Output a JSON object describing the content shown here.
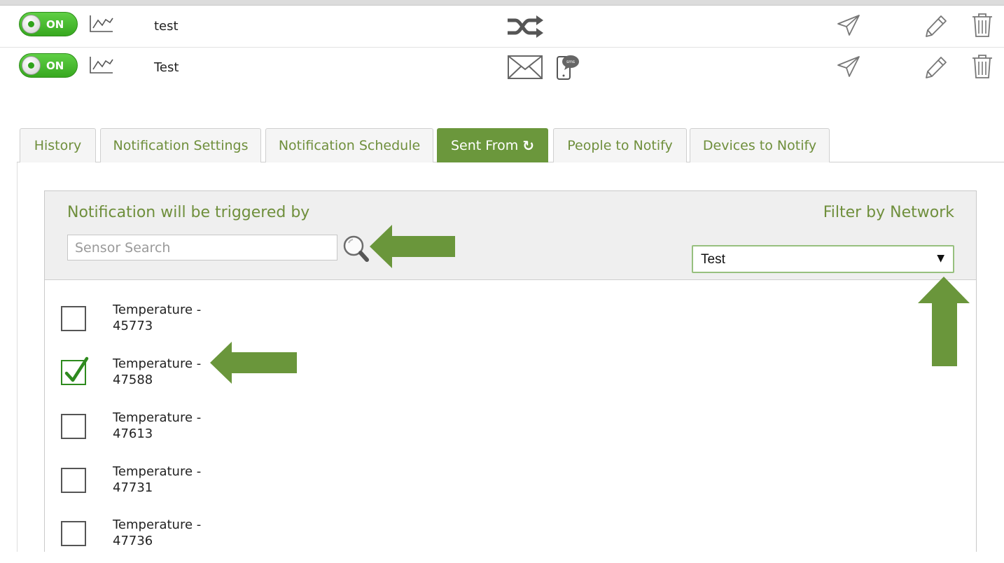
{
  "notifications": [
    {
      "toggle_label": "ON",
      "name": "test",
      "delivery_icon": "shuffle-icon"
    },
    {
      "toggle_label": "ON",
      "name": "Test",
      "delivery_icons": [
        "email-icon",
        "sms-phone-icon"
      ]
    }
  ],
  "row_action_icons": [
    "send-icon",
    "edit-pencil-icon",
    "trash-icon"
  ],
  "tabs": [
    {
      "label": "History",
      "active": false
    },
    {
      "label": "Notification Settings",
      "active": false
    },
    {
      "label": "Notification Schedule",
      "active": false
    },
    {
      "label": "Sent From",
      "active": true,
      "icon": "refresh-icon"
    },
    {
      "label": "People to Notify",
      "active": false
    },
    {
      "label": "Devices to Notify",
      "active": false
    }
  ],
  "panel": {
    "trigger_title": "Notification will be triggered by",
    "filter_title": "Filter by Network",
    "search_placeholder": "Sensor Search",
    "search_value": "",
    "network_selected": "Test",
    "network_caret": "▼"
  },
  "sensors": [
    {
      "line1": "Temperature -",
      "line2": "45773",
      "checked": false
    },
    {
      "line1": "Temperature -",
      "line2": "47588",
      "checked": true
    },
    {
      "line1": "Temperature -",
      "line2": "47613",
      "checked": false
    },
    {
      "line1": "Temperature -",
      "line2": "47731",
      "checked": false
    },
    {
      "line1": "Temperature -",
      "line2": "47736",
      "checked": false
    }
  ],
  "colors": {
    "accent_green": "#6b973c",
    "toggle_green": "#37a81f",
    "annotation_arrow": "#6a963b",
    "check_green": "#2e8a1e"
  },
  "annotations": [
    "arrow-pointing-to-search-button",
    "arrow-pointing-to-checked-sensor",
    "arrow-pointing-to-network-dropdown"
  ]
}
